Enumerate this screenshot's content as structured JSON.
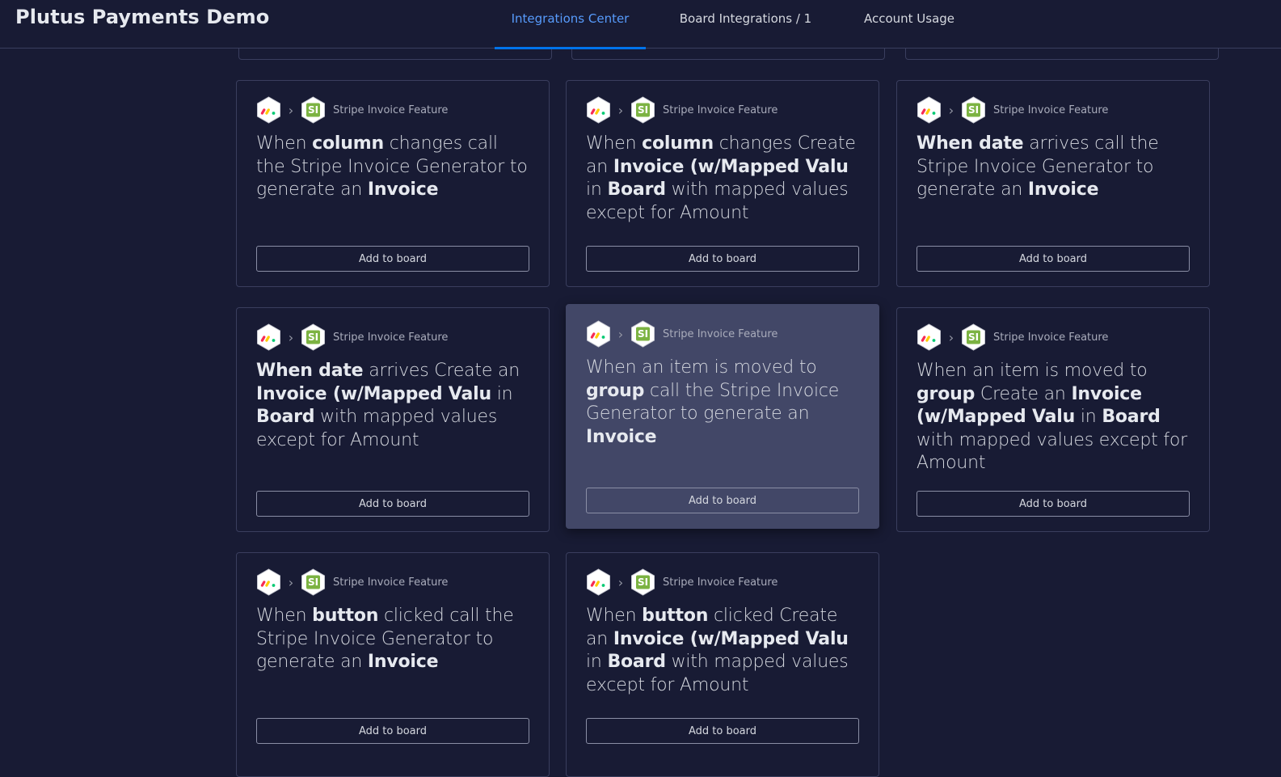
{
  "header": {
    "title": "Plutus Payments Demo",
    "tabs": [
      {
        "label": "Integrations Center",
        "active": true
      },
      {
        "label": "Board Integrations / 1",
        "active": false
      },
      {
        "label": "Account Usage",
        "active": false
      }
    ]
  },
  "colors": {
    "background": "#181b34",
    "active_tab": "#579bfc",
    "tab_underline": "#0073ea",
    "card_border": "#3a3e5e",
    "card_hover": "#424767",
    "stripe_invoice_green": "#7cb342"
  },
  "icons": {
    "source_app": "monday-logo-icon",
    "arrow": "chevron-right-icon",
    "target_app": "stripe-invoice-si-icon"
  },
  "cards": [
    {
      "feature": "Stripe Invoice Feature",
      "icon_text": "SI",
      "parts": [
        {
          "t": "When ",
          "b": false
        },
        {
          "t": "column",
          "b": true
        },
        {
          "t": " changes call the Stripe Invoice Generator to generate an ",
          "b": false
        },
        {
          "t": "Invoice",
          "b": true
        }
      ],
      "button": "Add to board"
    },
    {
      "feature": "Stripe Invoice Feature",
      "icon_text": "SI",
      "parts": [
        {
          "t": "When ",
          "b": false
        },
        {
          "t": "column",
          "b": true
        },
        {
          "t": " changes Create an ",
          "b": false
        },
        {
          "t": "Invoice (w/Mapped Valu",
          "b": true
        },
        {
          "t": " in ",
          "b": false
        },
        {
          "t": "Board",
          "b": true
        },
        {
          "t": " with mapped values except for Amount",
          "b": false
        }
      ],
      "button": "Add to board"
    },
    {
      "feature": "Stripe Invoice Feature",
      "icon_text": "SI",
      "parts": [
        {
          "t": "When ",
          "b": true
        },
        {
          "t": "date",
          "b": true
        },
        {
          "t": " arrives call the Stripe Invoice Generator to generate an ",
          "b": false
        },
        {
          "t": "Invoice",
          "b": true
        }
      ],
      "button": "Add to board"
    },
    {
      "feature": "Stripe Invoice Feature",
      "icon_text": "SI",
      "parts": [
        {
          "t": "When ",
          "b": true
        },
        {
          "t": "date",
          "b": true
        },
        {
          "t": " arrives Create an ",
          "b": false
        },
        {
          "t": "Invoice (w/Mapped Valu",
          "b": true
        },
        {
          "t": " in ",
          "b": false
        },
        {
          "t": "Board",
          "b": true
        },
        {
          "t": " with mapped values except for Amount",
          "b": false
        }
      ],
      "button": "Add to board"
    },
    {
      "feature": "Stripe Invoice Feature",
      "icon_text": "SI",
      "parts": [
        {
          "t": "When an item is moved to ",
          "b": false
        },
        {
          "t": "group",
          "b": true
        },
        {
          "t": " call the Stripe Invoice Generator to generate an ",
          "b": false
        },
        {
          "t": "Invoice",
          "b": true
        }
      ],
      "button": "Add to board"
    },
    {
      "feature": "Stripe Invoice Feature",
      "icon_text": "SI",
      "parts": [
        {
          "t": "When an item is moved to ",
          "b": false
        },
        {
          "t": "group",
          "b": true
        },
        {
          "t": " Create an ",
          "b": false
        },
        {
          "t": "Invoice (w/Mapped Valu",
          "b": true
        },
        {
          "t": " in ",
          "b": false
        },
        {
          "t": "Board",
          "b": true
        },
        {
          "t": " with mapped values except for Amount",
          "b": false
        }
      ],
      "button": "Add to board"
    },
    {
      "feature": "Stripe Invoice Feature",
      "icon_text": "SI",
      "parts": [
        {
          "t": "When ",
          "b": false
        },
        {
          "t": "button",
          "b": true
        },
        {
          "t": " clicked call the Stripe Invoice Generator to generate an ",
          "b": false
        },
        {
          "t": "Invoice",
          "b": true
        }
      ],
      "button": "Add to board"
    },
    {
      "feature": "Stripe Invoice Feature",
      "icon_text": "SI",
      "parts": [
        {
          "t": "When ",
          "b": false
        },
        {
          "t": "button",
          "b": true
        },
        {
          "t": " clicked Create an ",
          "b": false
        },
        {
          "t": "Invoice (w/Mapped Valu",
          "b": true
        },
        {
          "t": " in ",
          "b": false
        },
        {
          "t": "Board",
          "b": true
        },
        {
          "t": " with mapped values except for Amount",
          "b": false
        }
      ],
      "button": "Add to board"
    }
  ]
}
